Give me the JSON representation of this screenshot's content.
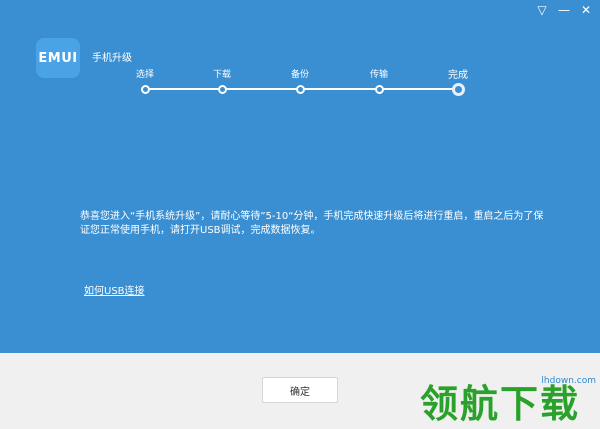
{
  "window": {
    "controls": [
      {
        "name": "dropdown",
        "glyph": "▽"
      },
      {
        "name": "minimize",
        "glyph": "—"
      },
      {
        "name": "close",
        "glyph": "✕"
      }
    ]
  },
  "logo": {
    "text": "EMUI"
  },
  "app_title": "手机升级",
  "steps": [
    {
      "label": "选择",
      "active": false
    },
    {
      "label": "下载",
      "active": false
    },
    {
      "label": "备份",
      "active": false
    },
    {
      "label": "传输",
      "active": false
    },
    {
      "label": "完成",
      "active": true
    }
  ],
  "message": "恭喜您进入“手机系统升级”，请耐心等待”5-10“分钟，手机完成快速升级后将进行重启，重启之后为了保证您正常使用手机，请打开USB调试，完成数据恢复。",
  "usb_link": "如何USB连接",
  "ok_button": "确定",
  "watermark": {
    "url": "lhdown.com",
    "text": "领航下载"
  },
  "colors": {
    "background": "#3a8fd2",
    "footer": "#f0f0f0",
    "watermark": "#2aa12a"
  }
}
